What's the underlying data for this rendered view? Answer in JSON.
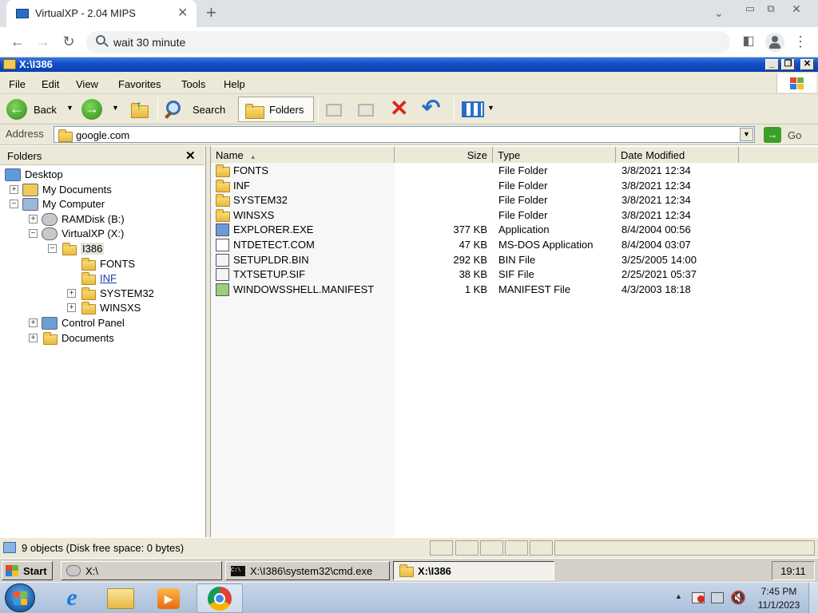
{
  "browser": {
    "tab_title": "VirtualXP - 2.04 MIPS",
    "omnibox_value": "wait 30 minute"
  },
  "window": {
    "title": "X:\\I386"
  },
  "menu": [
    "File",
    "Edit",
    "View",
    "Favorites",
    "Tools",
    "Help"
  ],
  "toolbar": {
    "back_label": "Back",
    "search_label": "Search",
    "folders_label": "Folders"
  },
  "address": {
    "label": "Address",
    "value": "google.com",
    "go_label": "Go"
  },
  "folders_pane": {
    "title": "Folders",
    "tree": [
      {
        "label": "Desktop",
        "level": 0,
        "expander": "",
        "icon": "desktop-icon"
      },
      {
        "label": "My Documents",
        "level": 1,
        "expander": "+",
        "icon": "my-documents-icon"
      },
      {
        "label": "My Computer",
        "level": 1,
        "expander": "−",
        "icon": "my-computer-icon"
      },
      {
        "label": "RAMDisk (B:)",
        "level": 2,
        "expander": "+",
        "icon": "drive-icon"
      },
      {
        "label": "VirtualXP (X:)",
        "level": 2,
        "expander": "−",
        "icon": "drive-icon"
      },
      {
        "label": "I386",
        "level": 3,
        "expander": "−",
        "icon": "folder-icon",
        "selected": true
      },
      {
        "label": "FONTS",
        "level": 4,
        "expander": "",
        "icon": "folder-icon"
      },
      {
        "label": "INF",
        "level": 4,
        "expander": "",
        "icon": "folder-icon",
        "hover": true
      },
      {
        "label": "SYSTEM32",
        "level": 4,
        "expander": "+",
        "icon": "folder-icon"
      },
      {
        "label": "WINSXS",
        "level": 4,
        "expander": "+",
        "icon": "folder-icon"
      },
      {
        "label": "Control Panel",
        "level": 2,
        "expander": "+",
        "icon": "control-panel-icon"
      },
      {
        "label": "Documents",
        "level": 2,
        "expander": "+",
        "icon": "folder-icon"
      }
    ]
  },
  "file_list": {
    "columns": [
      "Name",
      "Size",
      "Type",
      "Date Modified"
    ],
    "rows": [
      {
        "name": "FONTS",
        "size": "",
        "type": "File Folder",
        "date": "3/8/2021 12:34",
        "icon": "folder-icon"
      },
      {
        "name": "INF",
        "size": "",
        "type": "File Folder",
        "date": "3/8/2021 12:34",
        "icon": "folder-icon"
      },
      {
        "name": "SYSTEM32",
        "size": "",
        "type": "File Folder",
        "date": "3/8/2021 12:34",
        "icon": "folder-icon"
      },
      {
        "name": "WINSXS",
        "size": "",
        "type": "File Folder",
        "date": "3/8/2021 12:34",
        "icon": "folder-icon"
      },
      {
        "name": "EXPLORER.EXE",
        "size": "377 KB",
        "type": "Application",
        "date": "8/4/2004 00:56",
        "icon": "application-icon"
      },
      {
        "name": "NTDETECT.COM",
        "size": "47 KB",
        "type": "MS-DOS Application",
        "date": "8/4/2004 03:07",
        "icon": "dos-app-icon"
      },
      {
        "name": "SETUPLDR.BIN",
        "size": "292 KB",
        "type": "BIN File",
        "date": "3/25/2005 14:00",
        "icon": "file-icon"
      },
      {
        "name": "TXTSETUP.SIF",
        "size": "38 KB",
        "type": "SIF File",
        "date": "2/25/2021 05:37",
        "icon": "file-icon"
      },
      {
        "name": "WINDOWSSHELL.MANIFEST",
        "size": "1 KB",
        "type": "MANIFEST File",
        "date": "4/3/2003 18:18",
        "icon": "manifest-icon"
      }
    ]
  },
  "status": {
    "text": "9 objects (Disk free space: 0 bytes)"
  },
  "xp_taskbar": {
    "start_label": "Start",
    "tasks": [
      "X:\\",
      "X:\\I386\\system32\\cmd.exe",
      "X:\\I386"
    ],
    "clock": "19:11"
  },
  "win7_taskbar": {
    "time": "7:45 PM",
    "date": "11/1/2023"
  }
}
